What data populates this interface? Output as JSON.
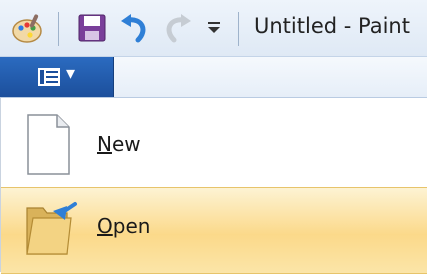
{
  "window": {
    "title": "Untitled - Paint"
  },
  "quick_access": {
    "icons": [
      "paint-app-icon",
      "save-icon",
      "undo-icon",
      "redo-icon",
      "customize-dropdown-icon"
    ]
  },
  "app_menu_button": {
    "icon": "menu-list-icon",
    "arrow": "▾"
  },
  "menu": {
    "items": [
      {
        "mnemonic": "N",
        "rest": "ew",
        "icon": "new-document-icon",
        "highlighted": false
      },
      {
        "mnemonic": "O",
        "rest": "pen",
        "icon": "open-folder-icon",
        "highlighted": true
      }
    ]
  },
  "colors": {
    "app_button": "#1c4f9c",
    "highlight": "#fbd98a"
  }
}
